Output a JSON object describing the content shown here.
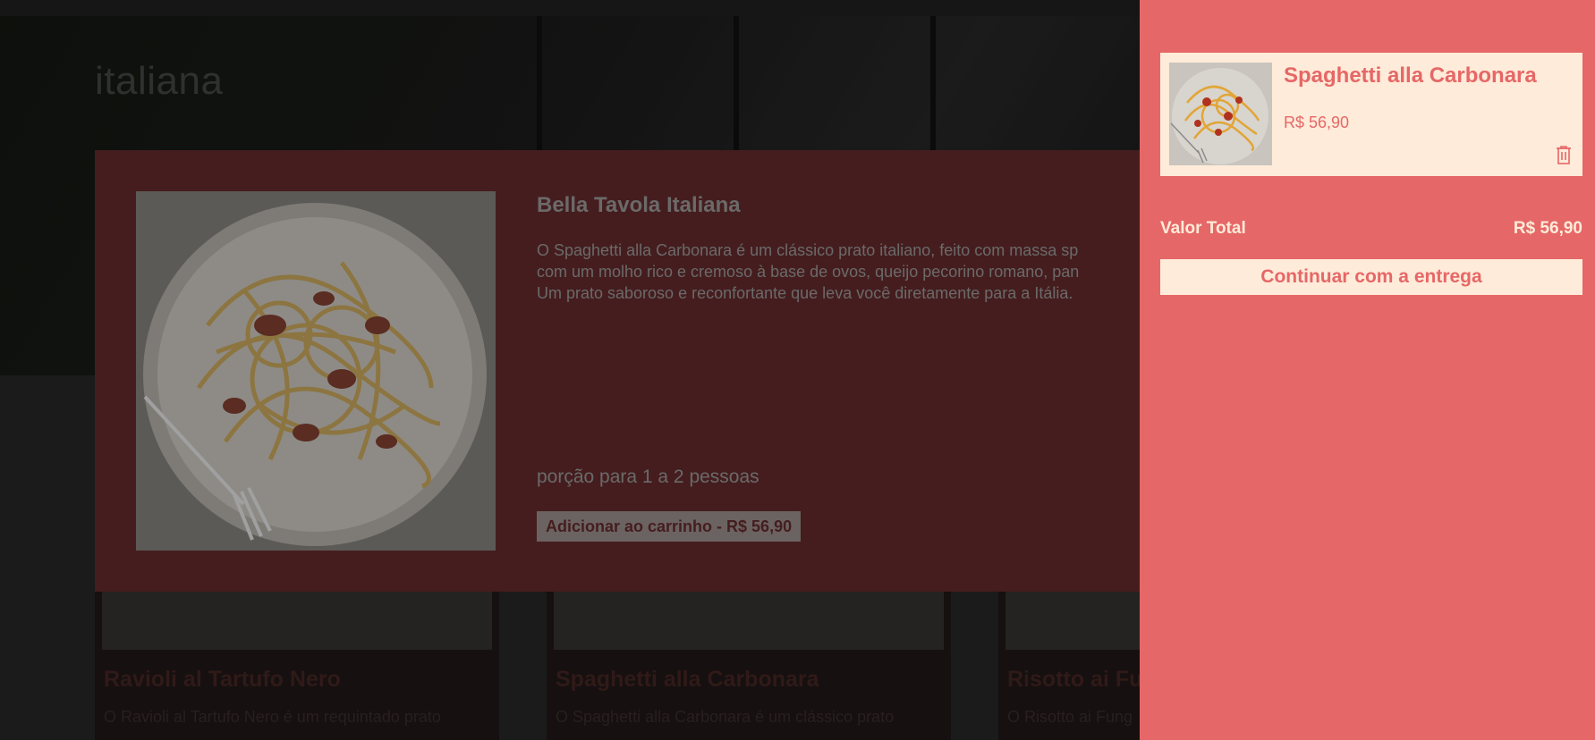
{
  "hero": {
    "title": "italiana"
  },
  "cards": [
    {
      "title": "Ravioli al Tartufo Nero",
      "desc": "O Ravioli al Tartufo Nero é um requintado prato"
    },
    {
      "title": "Spaghetti alla Carbonara",
      "desc": "O Spaghetti alla Carbonara é um clássico prato"
    },
    {
      "title": "Risotto ai Fu",
      "desc": "O Risotto ai Fung"
    }
  ],
  "modal": {
    "title": "Bella Tavola Italiana",
    "desc_lines": [
      "O Spaghetti alla Carbonara é um clássico prato italiano, feito com massa sp",
      "com um molho rico e cremoso à base de ovos, queijo pecorino romano, pan",
      "Um prato saboroso e reconfortante que leva você diretamente para a Itália."
    ],
    "portion": "porção para 1 a 2 pessoas",
    "add_button": "Adicionar ao carrinho - R$ 56,90",
    "image_icon": "spaghetti-carbonara-dish"
  },
  "cart": {
    "items": [
      {
        "name": "Spaghetti alla Carbonara",
        "price": "R$ 56,90",
        "image_icon": "spaghetti-carbonara-dish",
        "remove_icon": "trash-icon"
      }
    ],
    "total_label": "Valor Total",
    "total_value": "R$ 56,90",
    "continue_button": "Continuar com a entrega"
  },
  "colors": {
    "accent": "#e66767",
    "cream": "#ffebd9",
    "modal_bg": "#451d1f"
  }
}
